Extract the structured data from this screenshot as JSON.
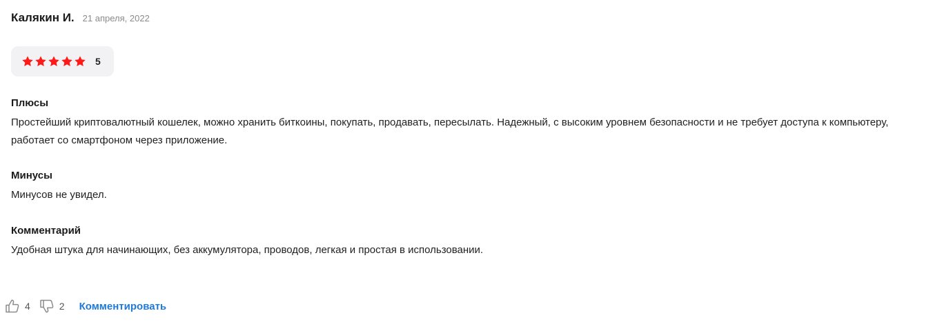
{
  "review": {
    "author": "Калякин И.",
    "date": "21 апреля, 2022",
    "rating": {
      "value": "5",
      "stars_filled": 5,
      "stars_total": 5,
      "star_color": "#ff1a1a"
    },
    "pros": {
      "title": "Плюсы",
      "text": "Простейший криптовалютный кошелек, можно хранить биткоины, покупать, продавать, пересылать. Надежный, с высоким уровнем безопасности и не требует доступа к компьютеру, работает со смартфоном через приложение."
    },
    "cons": {
      "title": "Минусы",
      "text": "Минусов не увидел."
    },
    "comment": {
      "title": "Комментарий",
      "text": "Удобная штука для начинающих, без аккумулятора, проводов, легкая и простая в использовании."
    },
    "footer": {
      "likes": "4",
      "dislikes": "2",
      "comment_link": "Комментировать",
      "like_icon": "thumbs-up-icon",
      "dislike_icon": "thumbs-down-icon",
      "link_color": "#1f7ad9"
    }
  }
}
